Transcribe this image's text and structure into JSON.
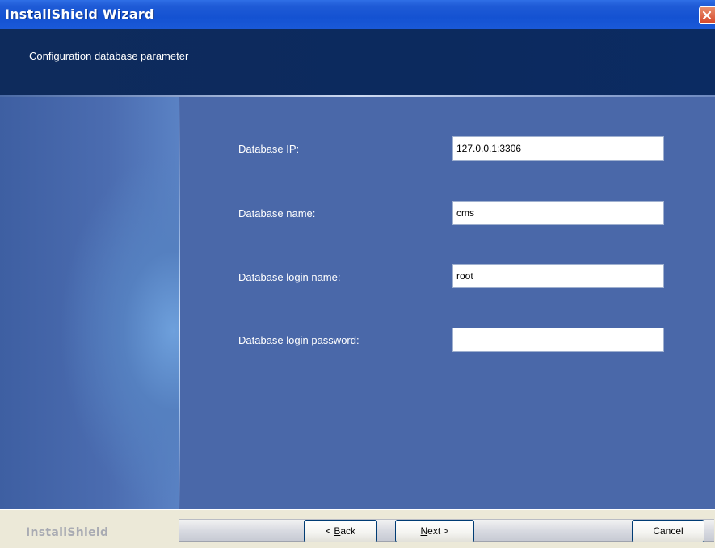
{
  "window": {
    "title": "InstallShield Wizard"
  },
  "header": {
    "title": "Configuration database parameter"
  },
  "fields": [
    {
      "label": "Database IP:",
      "value": "127.0.0.1:3306"
    },
    {
      "label": "Database name:",
      "value": "cms"
    },
    {
      "label": "Database login name:",
      "value": "root"
    },
    {
      "label": "Database login password:",
      "value": ""
    }
  ],
  "footer": {
    "brand": "InstallShield",
    "back": {
      "prefix": "< ",
      "accel": "B",
      "rest": "ack"
    },
    "next": {
      "accel": "N",
      "rest": "ext >"
    },
    "cancel": "Cancel"
  },
  "colors": {
    "title_bar": "#1452d2",
    "header_bg": "#0c2a5e",
    "body_bg": "#4a68a9",
    "close_button": "#d4462a"
  },
  "icons": {
    "close": "close-icon"
  }
}
